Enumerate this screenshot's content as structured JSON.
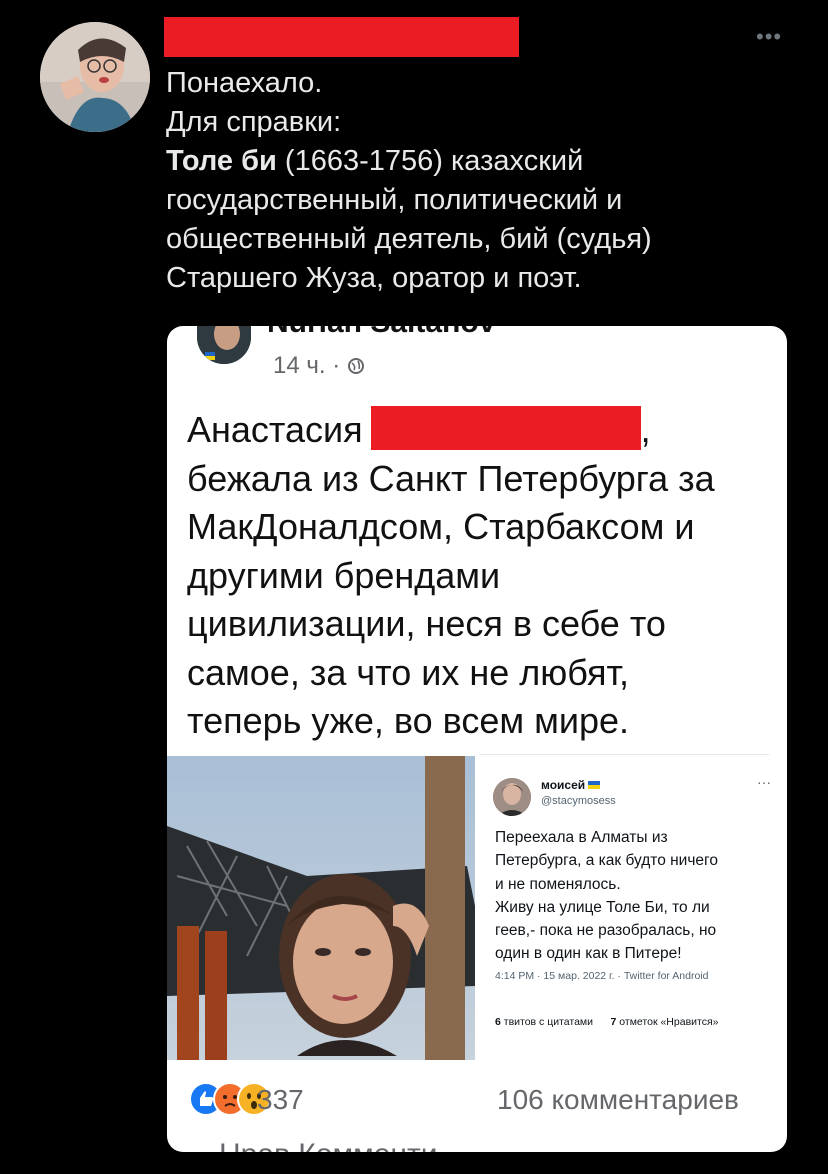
{
  "tweet": {
    "more_label": "•••",
    "lines": [
      {
        "text": "Понаехало."
      },
      {
        "text": "Для справки:"
      },
      {
        "bold": "Толе би",
        "rest": " (1663-1756) казахский"
      },
      {
        "text": "государственный, политический и"
      },
      {
        "text": "общественный деятель, бий (судья)"
      },
      {
        "text": "Старшего Жуза, оратор и поэт."
      }
    ]
  },
  "fb_post": {
    "author": "Nurlan Saitanov",
    "time": "14 ч. · ",
    "time_icon": "globe-icon",
    "text_first_name": "Анастасия",
    "text_after_redaction": ",",
    "text_lines": [
      "бежала из Санкт Петербурга за",
      "МакДоналдсом, Старбаксом и",
      "другими брендами",
      "цивилизации, неся в себе то",
      "самое, за что их не любят,",
      "теперь уже, во всем мире."
    ],
    "reactions_count": "337",
    "comments_count": "106 комментариев",
    "bottom_partial": "Нрав    Комменти"
  },
  "embedded_tweet": {
    "name": "моисей",
    "handle": "@stacymosess",
    "more": "···",
    "lines": [
      "Переехала в Алматы из",
      "Петербурга, а как будто ничего",
      "и не поменялось.",
      "Живу на улице Толе Би, то ли",
      "геев,- пока не разобралась, но",
      "один в один как в Питере!"
    ],
    "meta": "4:14 PM · 15 мар. 2022 г. · Twitter for Android",
    "quotes_count": "6",
    "quotes_label": " твитов с цитатами",
    "likes_count": "7",
    "likes_label": " отметок «Нравится»"
  },
  "colors": {
    "redaction": "#ec1c24",
    "background": "#000000",
    "card": "#ffffff",
    "fb_gray": "#65676b"
  }
}
